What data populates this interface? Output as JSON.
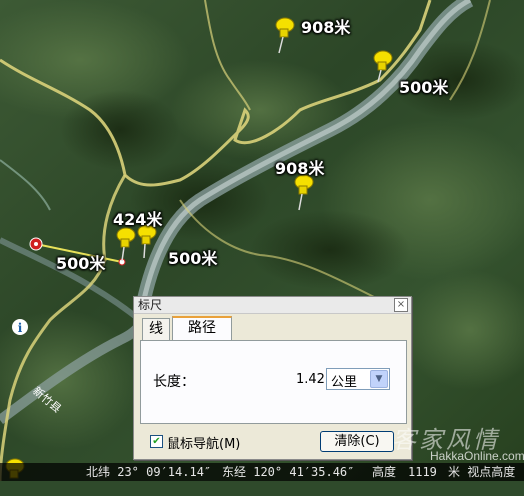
{
  "map": {
    "labels": [
      {
        "id": "label-908-top",
        "text": "908米"
      },
      {
        "id": "label-500-topright",
        "text": "500米"
      },
      {
        "id": "label-908-mid",
        "text": "908米"
      },
      {
        "id": "label-424",
        "text": "424米"
      },
      {
        "id": "label-500-left",
        "text": "500米"
      },
      {
        "id": "label-500-center",
        "text": "500米"
      }
    ],
    "village_label": "新竹县",
    "info_icon": "i"
  },
  "ruler": {
    "title": "标尺",
    "close_glyph": "×",
    "tabs": [
      {
        "label": "线",
        "active": false
      },
      {
        "label": "路径",
        "active": true
      }
    ],
    "length_label": "长度：",
    "length_value": "1.42",
    "unit_selected": "公里",
    "mouse_nav_label": "鼠标导航(M)",
    "mouse_nav_checked": true,
    "clear_label": "清除(C)"
  },
  "status_bar": {
    "lat": "北纬  23° 09′14.14″",
    "lon": "东经 120° 41′35.46″",
    "alt": "高度",
    "tail": "1119",
    "mid": "米 视点高度"
  },
  "watermark": {
    "text": "客家风情",
    "site": "HakkaOnline.com"
  },
  "colors": {
    "path": "#e8e25a",
    "road": "#d9d27a",
    "river": "#9fb3b8",
    "pin": "#f5e000",
    "accent_tab": "#e9a13b"
  }
}
